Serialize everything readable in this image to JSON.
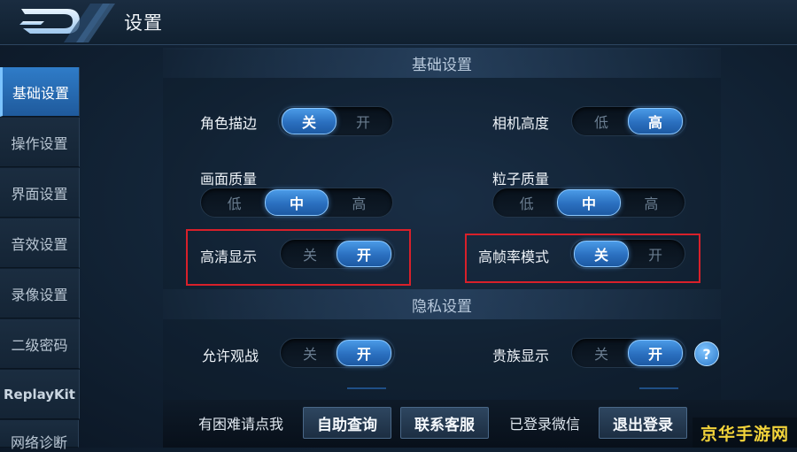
{
  "header": {
    "title": "设置"
  },
  "sidebar": {
    "items": [
      {
        "label": "基础设置",
        "active": true
      },
      {
        "label": "操作设置"
      },
      {
        "label": "界面设置"
      },
      {
        "label": "音效设置"
      },
      {
        "label": "录像设置"
      },
      {
        "label": "二级密码"
      },
      {
        "label": "ReplayKit"
      },
      {
        "label": "网络诊断"
      }
    ]
  },
  "sections": {
    "basic": "基础设置",
    "privacy": "隐私设置"
  },
  "settings": {
    "outline": {
      "label": "角色描边",
      "off": "关",
      "on": "开",
      "selected": "关"
    },
    "camera_height": {
      "label": "相机高度",
      "low": "低",
      "high": "高",
      "selected": "高"
    },
    "quality": {
      "label": "画面质量",
      "low": "低",
      "mid": "中",
      "high": "高",
      "selected": "中"
    },
    "particle": {
      "label": "粒子质量",
      "low": "低",
      "mid": "中",
      "high": "高",
      "selected": "中"
    },
    "hd_display": {
      "label": "高清显示",
      "off": "关",
      "on": "开",
      "selected": "开"
    },
    "high_fps": {
      "label": "高帧率模式",
      "off": "关",
      "on": "开",
      "selected": "关"
    },
    "allow_spectate": {
      "label": "允许观战",
      "off": "关",
      "on": "开",
      "selected": "开"
    },
    "noble_display": {
      "label": "贵族显示",
      "off": "关",
      "on": "开",
      "selected": "开"
    }
  },
  "help_icon": {
    "glyph": "?"
  },
  "bottom": {
    "help_text": "有困难请点我",
    "self_service": "自助查询",
    "contact_support": "联系客服",
    "wechat_status": "已登录微信",
    "logout": "退出登录"
  },
  "watermark": "京华手游网",
  "colors": {
    "accent": "#2a6fbf",
    "highlight_box": "#d8202a",
    "watermark": "#f2d33a"
  }
}
